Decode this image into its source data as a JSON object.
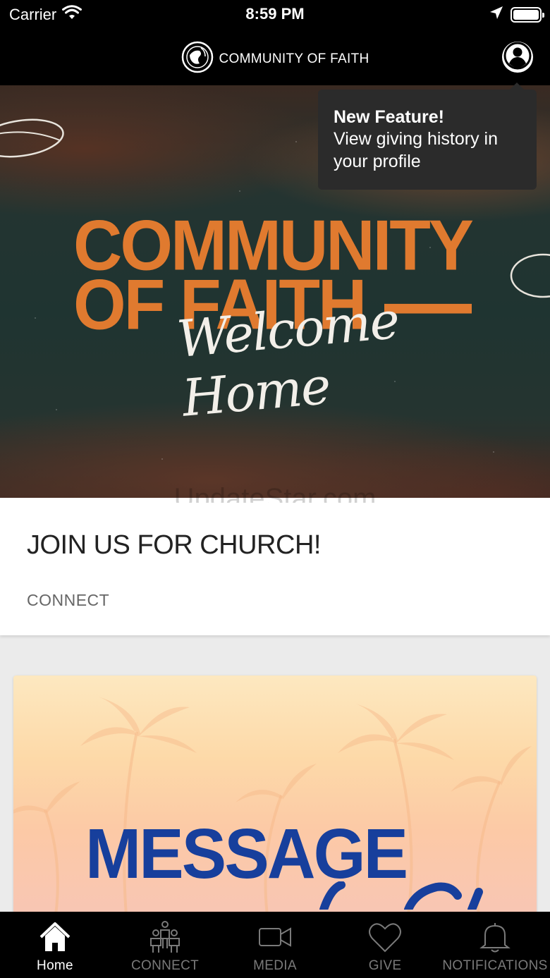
{
  "status_bar": {
    "carrier": "Carrier",
    "time": "8:59 PM"
  },
  "header": {
    "title": "COMMUNITY OF FAITH",
    "logo_icon": "globe-logo-icon",
    "profile_icon": "user-profile-icon"
  },
  "tooltip": {
    "title": "New Feature!",
    "body": "View giving history in your profile"
  },
  "hero": {
    "title_line1": "COMMUNITY",
    "title_line2": "OF FAITH",
    "subtitle": "Welcome Home",
    "accent_color": "#e07a2f"
  },
  "watermark": "UpdateStar.com",
  "card": {
    "title": "JOIN US FOR CHURCH!",
    "category": "CONNECT"
  },
  "message_card": {
    "title": "MESSAGE",
    "title_color": "#173f9c"
  },
  "tab_bar": {
    "tabs": [
      {
        "label": "Home",
        "icon": "home-icon",
        "active": true
      },
      {
        "label": "CONNECT",
        "icon": "people-icon",
        "active": false
      },
      {
        "label": "MEDIA",
        "icon": "video-camera-icon",
        "active": false
      },
      {
        "label": "GIVE",
        "icon": "heart-icon",
        "active": false
      },
      {
        "label": "NOTIFICATIONS",
        "icon": "bell-icon",
        "active": false
      }
    ]
  }
}
